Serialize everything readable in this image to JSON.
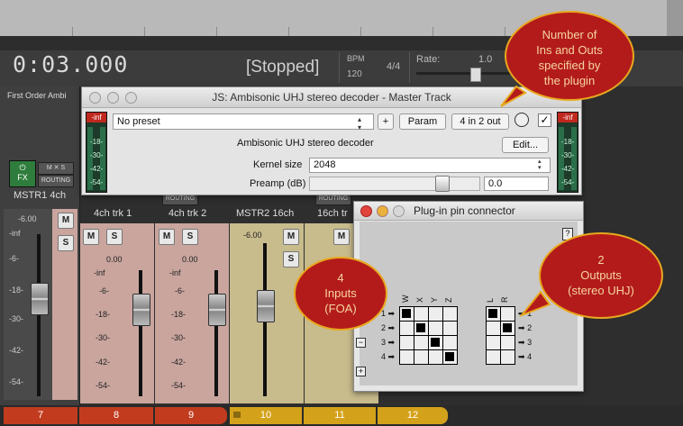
{
  "transport": {
    "time": "0:03.000",
    "status": "[Stopped]",
    "bpm_label": "BPM",
    "bpm_value": "120",
    "time_sig": "4/4",
    "rate_label": "Rate:",
    "rate_value": "1.0"
  },
  "master": {
    "top_label": "First Order Ambi",
    "fx_label": "FX",
    "routing_label": "ROUTING",
    "name": "MSTR1 4ch",
    "vol": "-6.00",
    "scale": [
      "-inf",
      "-6-",
      "-18-",
      "-30-",
      "-42-",
      "-54-"
    ]
  },
  "tracks": [
    {
      "name": "4ch trk 1",
      "vol": "0.00",
      "num": "8"
    },
    {
      "name": "4ch trk 2",
      "vol": "0.00",
      "num": "9"
    },
    {
      "name": "MSTR2 16ch",
      "vol": "-6.00",
      "num": "10"
    },
    {
      "name": "16ch tr",
      "vol": "",
      "num": "11"
    }
  ],
  "track_numbers": [
    "7",
    "8",
    "9",
    "10",
    "11",
    "12"
  ],
  "strip_scale": [
    "-inf",
    "-6-",
    "-18-",
    "-30-",
    "-42-",
    "-54-"
  ],
  "ms": {
    "m": "M",
    "s": "S"
  },
  "js_window": {
    "title": "JS: Ambisonic UHJ stereo decoder - Master Track",
    "preset": "No preset",
    "plus": "+",
    "param": "Param",
    "io": "4 in 2 out",
    "check": "✓",
    "plugin_name": "Ambisonic UHJ stereo decoder",
    "edit": "Edit...",
    "kernel_label": "Kernel size",
    "kernel_value": "2048",
    "preamp_label": "Preamp (dB)",
    "preamp_value": "0.0",
    "meter_left": {
      "top": "-inf",
      "ticks": [
        "-18-",
        "-30-",
        "-42-",
        "-54-"
      ]
    },
    "meter_right": {
      "top": "-inf",
      "ticks": [
        "-18-",
        "-30-",
        "-42-",
        "-54-"
      ]
    }
  },
  "pin_connector": {
    "title": "Plug-in pin connector",
    "help": "?",
    "input_cols": [
      "W",
      "X",
      "Y",
      "Z"
    ],
    "output_cols": [
      "L",
      "R"
    ],
    "rows": [
      "1",
      "2",
      "3",
      "4"
    ],
    "input_matrix": [
      [
        1,
        0,
        0,
        0
      ],
      [
        0,
        1,
        0,
        0
      ],
      [
        0,
        0,
        1,
        0
      ],
      [
        0,
        0,
        0,
        1
      ]
    ],
    "output_matrix": [
      [
        1,
        0
      ],
      [
        0,
        1
      ],
      [
        0,
        0
      ],
      [
        0,
        0
      ]
    ],
    "minus": "−",
    "plus": "+"
  },
  "callouts": {
    "top": [
      "Number of",
      "Ins and Outs",
      "specified by",
      "the plugin"
    ],
    "left": [
      "4",
      "Inputs",
      "(FOA)"
    ],
    "right": [
      "2",
      "Outputs",
      "(stereo UHJ)"
    ]
  },
  "colors": {
    "callout_fill": "#b31b1b",
    "callout_border": "#e8a81e",
    "track_red": "#c23b1e",
    "track_yellow": "#d4a21a"
  }
}
